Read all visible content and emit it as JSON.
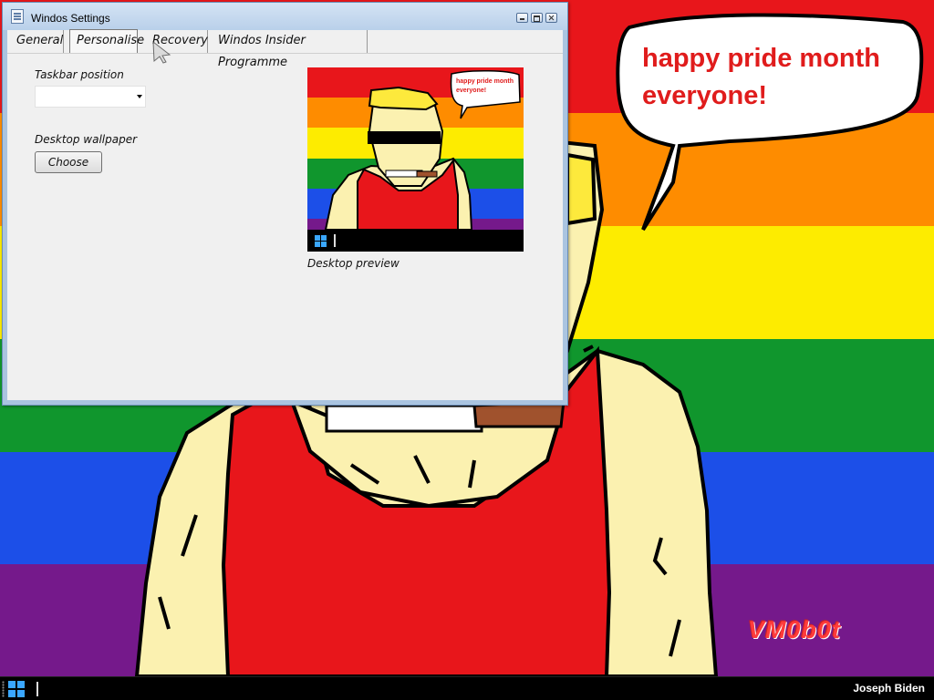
{
  "desktop": {
    "speech_bubble": "happy pride month everyone!",
    "signature": "VM0b0t",
    "rainbow_colors": [
      "#e8161b",
      "#fe8c00",
      "#fdec00",
      "#10962d",
      "#1c4fe8",
      "#75198b"
    ]
  },
  "window": {
    "title": "Windos Settings",
    "controls": [
      "minimize-icon",
      "maximize-icon",
      "close-icon"
    ],
    "tabs": [
      {
        "label": "General"
      },
      {
        "label": "Personalise",
        "selected": true
      },
      {
        "label": "Recovery"
      },
      {
        "label": "Windos Insider Programme"
      }
    ],
    "personalise": {
      "taskbar_position_label": "Taskbar position",
      "taskbar_position_value": "",
      "wallpaper_label": "Desktop wallpaper",
      "choose_button": "Choose",
      "preview_caption": "Desktop preview",
      "preview_bubble": "happy pride month everyone!"
    }
  },
  "taskbar": {
    "start_icon": "windows-logo-icon",
    "user": "Joseph Biden"
  }
}
